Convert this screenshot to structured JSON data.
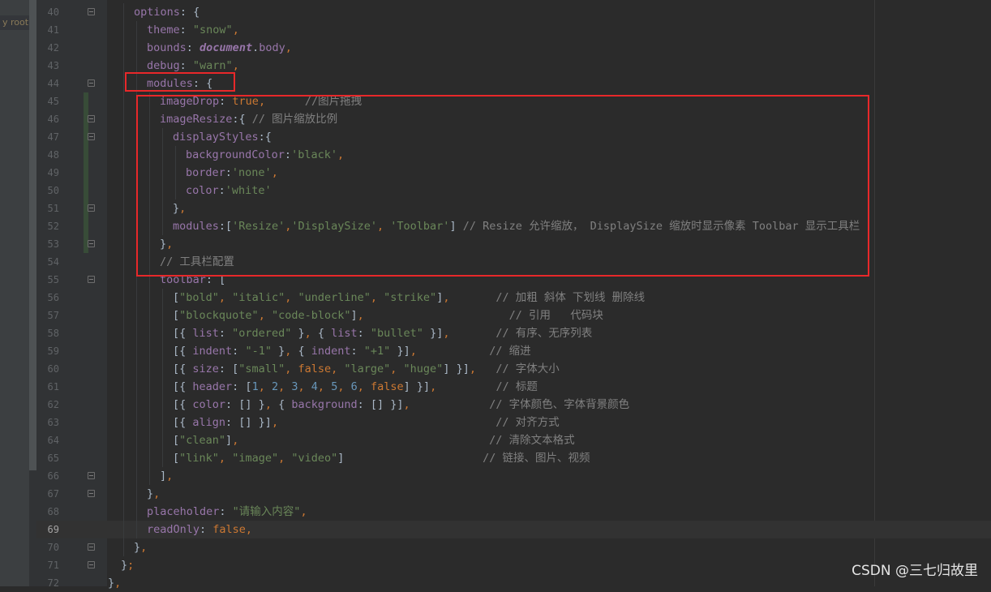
{
  "sidebar": {
    "label": "y root"
  },
  "watermark": "CSDN @三七归故里",
  "editor": {
    "active_line": 69,
    "highlight_color": "#e8282a",
    "lines": [
      {
        "n": 40,
        "indent": 2,
        "fold": true,
        "tokens": [
          [
            "k",
            "options"
          ],
          [
            "p",
            ": {"
          ]
        ]
      },
      {
        "n": 41,
        "indent": 3,
        "tokens": [
          [
            "k",
            "theme"
          ],
          [
            "p",
            ": "
          ],
          [
            "s",
            "\"snow\""
          ],
          [
            "kw",
            ","
          ]
        ]
      },
      {
        "n": 42,
        "indent": 3,
        "tokens": [
          [
            "k",
            "bounds"
          ],
          [
            "p",
            ": "
          ],
          [
            "fn",
            "document"
          ],
          [
            "p",
            "."
          ],
          [
            "k",
            "body"
          ],
          [
            "kw",
            ","
          ]
        ]
      },
      {
        "n": 43,
        "indent": 3,
        "tokens": [
          [
            "k",
            "debug"
          ],
          [
            "p",
            ": "
          ],
          [
            "s",
            "\"warn\""
          ],
          [
            "kw",
            ","
          ]
        ]
      },
      {
        "n": 44,
        "indent": 3,
        "fold": true,
        "tokens": [
          [
            "k",
            "modules"
          ],
          [
            "p",
            ": {"
          ]
        ]
      },
      {
        "n": 45,
        "indent": 4,
        "changed": true,
        "tokens": [
          [
            "k",
            "imageDrop"
          ],
          [
            "p",
            ": "
          ],
          [
            "kw",
            "true"
          ],
          [
            "kw",
            ","
          ],
          [
            "c",
            "      //图片拖拽"
          ]
        ]
      },
      {
        "n": 46,
        "indent": 4,
        "changed": true,
        "fold": true,
        "tokens": [
          [
            "k",
            "imageResize"
          ],
          [
            "p",
            ":{ "
          ],
          [
            "c",
            "// 图片缩放比例"
          ]
        ]
      },
      {
        "n": 47,
        "indent": 5,
        "changed": true,
        "fold": true,
        "tokens": [
          [
            "k",
            "displayStyles"
          ],
          [
            "p",
            ":{"
          ]
        ]
      },
      {
        "n": 48,
        "indent": 6,
        "changed": true,
        "tokens": [
          [
            "k",
            "backgroundColor"
          ],
          [
            "p",
            ":"
          ],
          [
            "s",
            "'black'"
          ],
          [
            "kw",
            ","
          ]
        ]
      },
      {
        "n": 49,
        "indent": 6,
        "changed": true,
        "tokens": [
          [
            "k",
            "border"
          ],
          [
            "p",
            ":"
          ],
          [
            "s",
            "'none'"
          ],
          [
            "kw",
            ","
          ]
        ]
      },
      {
        "n": 50,
        "indent": 6,
        "changed": true,
        "tokens": [
          [
            "k",
            "color"
          ],
          [
            "p",
            ":"
          ],
          [
            "s",
            "'white'"
          ]
        ]
      },
      {
        "n": 51,
        "indent": 5,
        "changed": true,
        "fold": true,
        "tokens": [
          [
            "p",
            "}"
          ],
          [
            "kw",
            ","
          ]
        ]
      },
      {
        "n": 52,
        "indent": 5,
        "changed": true,
        "tokens": [
          [
            "k",
            "modules"
          ],
          [
            "p",
            ":["
          ],
          [
            "s",
            "'Resize'"
          ],
          [
            "kw",
            ","
          ],
          [
            "s",
            "'DisplaySize'"
          ],
          [
            "kw",
            ", "
          ],
          [
            "s",
            "'Toolbar'"
          ],
          [
            "p",
            "] "
          ],
          [
            "c",
            "// Resize 允许缩放， DisplaySize 缩放时显示像素 Toolbar 显示工具栏"
          ]
        ]
      },
      {
        "n": 53,
        "indent": 4,
        "changed": true,
        "fold": true,
        "tokens": [
          [
            "p",
            "}"
          ],
          [
            "kw",
            ","
          ]
        ]
      },
      {
        "n": 54,
        "indent": 4,
        "tokens": [
          [
            "c",
            "// 工具栏配置"
          ]
        ]
      },
      {
        "n": 55,
        "indent": 4,
        "fold": true,
        "tokens": [
          [
            "k",
            "toolbar"
          ],
          [
            "p",
            ": ["
          ]
        ]
      },
      {
        "n": 56,
        "indent": 5,
        "tokens": [
          [
            "p",
            "["
          ],
          [
            "s",
            "\"bold\""
          ],
          [
            "kw",
            ", "
          ],
          [
            "s",
            "\"italic\""
          ],
          [
            "kw",
            ", "
          ],
          [
            "s",
            "\"underline\""
          ],
          [
            "kw",
            ", "
          ],
          [
            "s",
            "\"strike\""
          ],
          [
            "p",
            "]"
          ],
          [
            "kw",
            ","
          ],
          [
            "c",
            "       // 加粗 斜体 下划线 删除线"
          ]
        ]
      },
      {
        "n": 57,
        "indent": 5,
        "tokens": [
          [
            "p",
            "["
          ],
          [
            "s",
            "\"blockquote\""
          ],
          [
            "kw",
            ", "
          ],
          [
            "s",
            "\"code-block\""
          ],
          [
            "p",
            "]"
          ],
          [
            "kw",
            ","
          ],
          [
            "c",
            "                      // 引用   代码块"
          ]
        ]
      },
      {
        "n": 58,
        "indent": 5,
        "tokens": [
          [
            "p",
            "[{ "
          ],
          [
            "k",
            "list"
          ],
          [
            "p",
            ": "
          ],
          [
            "s",
            "\"ordered\""
          ],
          [
            "p",
            " }"
          ],
          [
            "kw",
            ", "
          ],
          [
            "p",
            "{ "
          ],
          [
            "k",
            "list"
          ],
          [
            "p",
            ": "
          ],
          [
            "s",
            "\"bullet\""
          ],
          [
            "p",
            " }]"
          ],
          [
            "kw",
            ","
          ],
          [
            "c",
            "       // 有序、无序列表"
          ]
        ]
      },
      {
        "n": 59,
        "indent": 5,
        "tokens": [
          [
            "p",
            "[{ "
          ],
          [
            "k",
            "indent"
          ],
          [
            "p",
            ": "
          ],
          [
            "s",
            "\"-1\""
          ],
          [
            "p",
            " }"
          ],
          [
            "kw",
            ", "
          ],
          [
            "p",
            "{ "
          ],
          [
            "k",
            "indent"
          ],
          [
            "p",
            ": "
          ],
          [
            "s",
            "\"+1\""
          ],
          [
            "p",
            " }]"
          ],
          [
            "kw",
            ","
          ],
          [
            "c",
            "           // 缩进"
          ]
        ]
      },
      {
        "n": 60,
        "indent": 5,
        "tokens": [
          [
            "p",
            "[{ "
          ],
          [
            "k",
            "size"
          ],
          [
            "p",
            ": ["
          ],
          [
            "s",
            "\"small\""
          ],
          [
            "kw",
            ", false, "
          ],
          [
            "s",
            "\"large\""
          ],
          [
            "kw",
            ", "
          ],
          [
            "s",
            "\"huge\""
          ],
          [
            "p",
            "] }]"
          ],
          [
            "kw",
            ","
          ],
          [
            "c",
            "   // 字体大小"
          ]
        ]
      },
      {
        "n": 61,
        "indent": 5,
        "tokens": [
          [
            "p",
            "[{ "
          ],
          [
            "k",
            "header"
          ],
          [
            "p",
            ": ["
          ],
          [
            "n",
            "1"
          ],
          [
            "kw",
            ", "
          ],
          [
            "n",
            "2"
          ],
          [
            "kw",
            ", "
          ],
          [
            "n",
            "3"
          ],
          [
            "kw",
            ", "
          ],
          [
            "n",
            "4"
          ],
          [
            "kw",
            ", "
          ],
          [
            "n",
            "5"
          ],
          [
            "kw",
            ", "
          ],
          [
            "n",
            "6"
          ],
          [
            "kw",
            ", false"
          ],
          [
            "p",
            "] }]"
          ],
          [
            "kw",
            ","
          ],
          [
            "c",
            "         // 标题"
          ]
        ]
      },
      {
        "n": 62,
        "indent": 5,
        "tokens": [
          [
            "p",
            "[{ "
          ],
          [
            "k",
            "color"
          ],
          [
            "p",
            ": [] }"
          ],
          [
            "kw",
            ", "
          ],
          [
            "p",
            "{ "
          ],
          [
            "k",
            "background"
          ],
          [
            "p",
            ": [] }]"
          ],
          [
            "kw",
            ","
          ],
          [
            "c",
            "            // 字体颜色、字体背景颜色"
          ]
        ]
      },
      {
        "n": 63,
        "indent": 5,
        "tokens": [
          [
            "p",
            "[{ "
          ],
          [
            "k",
            "align"
          ],
          [
            "p",
            ": [] }]"
          ],
          [
            "kw",
            ","
          ],
          [
            "c",
            "                                 // 对齐方式"
          ]
        ]
      },
      {
        "n": 64,
        "indent": 5,
        "tokens": [
          [
            "p",
            "["
          ],
          [
            "s",
            "\"clean\""
          ],
          [
            "p",
            "]"
          ],
          [
            "kw",
            ","
          ],
          [
            "c",
            "                                      // 清除文本格式"
          ]
        ]
      },
      {
        "n": 65,
        "indent": 5,
        "tokens": [
          [
            "p",
            "["
          ],
          [
            "s",
            "\"link\""
          ],
          [
            "kw",
            ", "
          ],
          [
            "s",
            "\"image\""
          ],
          [
            "kw",
            ", "
          ],
          [
            "s",
            "\"video\""
          ],
          [
            "p",
            "]"
          ],
          [
            "c",
            "                     // 链接、图片、视频"
          ]
        ]
      },
      {
        "n": 66,
        "indent": 4,
        "fold": true,
        "tokens": [
          [
            "p",
            "]"
          ],
          [
            "kw",
            ","
          ]
        ]
      },
      {
        "n": 67,
        "indent": 3,
        "fold": true,
        "tokens": [
          [
            "p",
            "}"
          ],
          [
            "kw",
            ","
          ]
        ]
      },
      {
        "n": 68,
        "indent": 3,
        "tokens": [
          [
            "k",
            "placeholder"
          ],
          [
            "p",
            ": "
          ],
          [
            "s",
            "\"请输入内容\""
          ],
          [
            "kw",
            ","
          ]
        ]
      },
      {
        "n": 69,
        "indent": 3,
        "tokens": [
          [
            "k",
            "readOnly"
          ],
          [
            "p",
            ": "
          ],
          [
            "kw",
            "false,"
          ]
        ]
      },
      {
        "n": 70,
        "indent": 2,
        "fold": true,
        "tokens": [
          [
            "p",
            "}"
          ],
          [
            "kw",
            ","
          ]
        ]
      },
      {
        "n": 71,
        "indent": 1,
        "fold": true,
        "tokens": [
          [
            "p",
            "}"
          ],
          [
            "kw",
            ";"
          ]
        ]
      },
      {
        "n": 72,
        "indent": 0,
        "tokens": [
          [
            "p",
            "}"
          ],
          [
            "kw",
            ","
          ]
        ]
      }
    ]
  }
}
